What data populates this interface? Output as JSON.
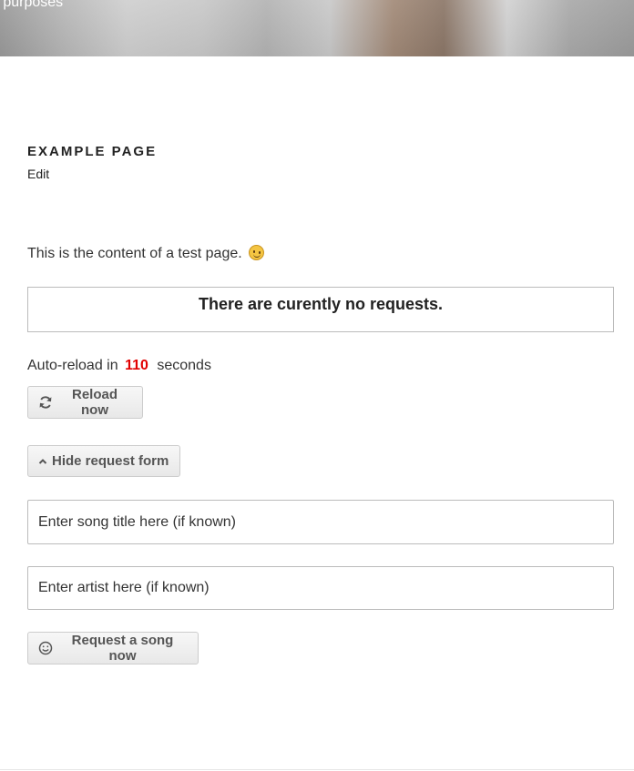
{
  "header": {
    "tagline": "g purposes"
  },
  "page": {
    "title": "EXAMPLE PAGE",
    "edit_label": "Edit",
    "content_text": "This is the content of a test page."
  },
  "requests": {
    "empty_message": "There are curently no requests."
  },
  "autoreload": {
    "prefix": "Auto-reload in",
    "countdown": "110",
    "suffix": "seconds",
    "countdown_color": "#e10000"
  },
  "buttons": {
    "reload_label": "Reload now",
    "hide_form_label": "Hide request form",
    "request_label": "Request a song now"
  },
  "form": {
    "title_placeholder": "Enter song title here (if known)",
    "artist_placeholder": "Enter artist here (if known)"
  },
  "icons": {
    "reload": "refresh-icon",
    "hide": "chevron-up-icon",
    "request": "smiley-icon",
    "content_emoji": "wink-emoji-icon"
  }
}
